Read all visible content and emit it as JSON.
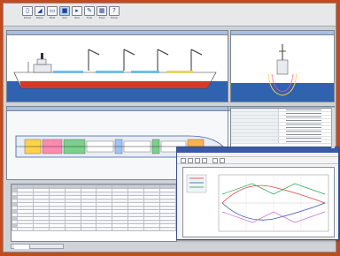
{
  "toolbar": {
    "buttons": [
      {
        "label": "Dxxd",
        "icon": "new-file-icon"
      },
      {
        "label": "Dxxn",
        "icon": "open-folder-icon"
      },
      {
        "label": "Pxxt",
        "icon": "print-icon"
      },
      {
        "label": "Vxx",
        "icon": "view-icon"
      },
      {
        "label": "Sxx",
        "icon": "select-icon"
      },
      {
        "label": "Txxl",
        "icon": "tool-icon"
      },
      {
        "label": "Txxx",
        "icon": "table-icon"
      },
      {
        "label": "Hxxp",
        "icon": "help-icon"
      }
    ]
  },
  "colors": {
    "background": "#c24a1c",
    "sea": "#2f63b0",
    "hull_red": "#d23a2a",
    "window_blue": "#3a5aa8"
  }
}
